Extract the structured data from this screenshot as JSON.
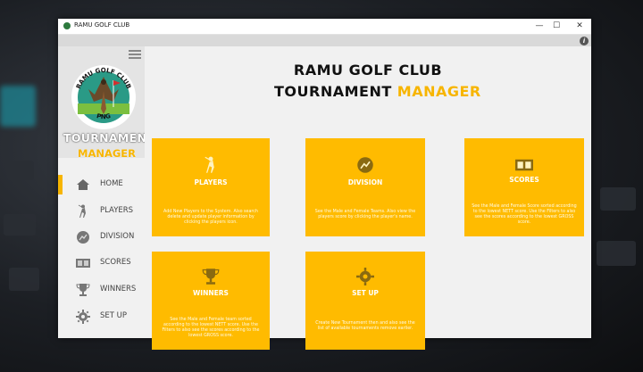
{
  "window": {
    "title": "RAMU GOLF CLUB",
    "controls": {
      "minimize": "—",
      "maximize": "☐",
      "close": "✕"
    },
    "info_icon": "info-icon"
  },
  "sidebar": {
    "logo_text_top": "RAMU GOLF CLUB",
    "logo_text_bottom": "PNG",
    "brand_line1": "TOURNAMENT",
    "brand_line2": "MANAGER",
    "items": [
      {
        "label": "HOME",
        "icon": "home-icon"
      },
      {
        "label": "PLAYERS",
        "icon": "golfer-icon"
      },
      {
        "label": "DIVISION",
        "icon": "division-icon"
      },
      {
        "label": "SCORES",
        "icon": "scoreboard-icon"
      },
      {
        "label": "WINNERS",
        "icon": "trophy-icon"
      },
      {
        "label": "SET UP",
        "icon": "gear-icon"
      }
    ],
    "active": "HOME"
  },
  "main": {
    "heading_line1": "RAMU GOLF CLUB",
    "heading_line2a": "TOURNAMENT",
    "heading_line2b": "MANAGER",
    "tiles": [
      {
        "title": "PLAYERS",
        "icon": "golfer-icon",
        "desc": "Add New Players to the System. Also search delete and update player information by clicking the players icon."
      },
      {
        "title": "DIVISION",
        "icon": "division-icon",
        "desc": "See the Male and Female Teams. Also view the players score by clicking the player's name."
      },
      {
        "title": "SCORES",
        "icon": "scoreboard-icon",
        "desc": "See the Male and Female Score sorted according to the lowest NETT score. Use the Filters to also see the scores according to the lowest GROSS score."
      },
      {
        "title": "WINNERS",
        "icon": "trophy-icon",
        "desc": "See the Male and Female team sorted according to the lowest NETT score. Use the Filters to also see the scores according to the lowest GROSS score."
      },
      {
        "title": "SET UP",
        "icon": "gear-icon",
        "desc": "Create New Tournament then and also see the list of available tournaments remove earlier."
      }
    ]
  },
  "colors": {
    "accent": "#f7b500",
    "tile": "#ffbb00",
    "sidebar": "#f1f1f1"
  }
}
